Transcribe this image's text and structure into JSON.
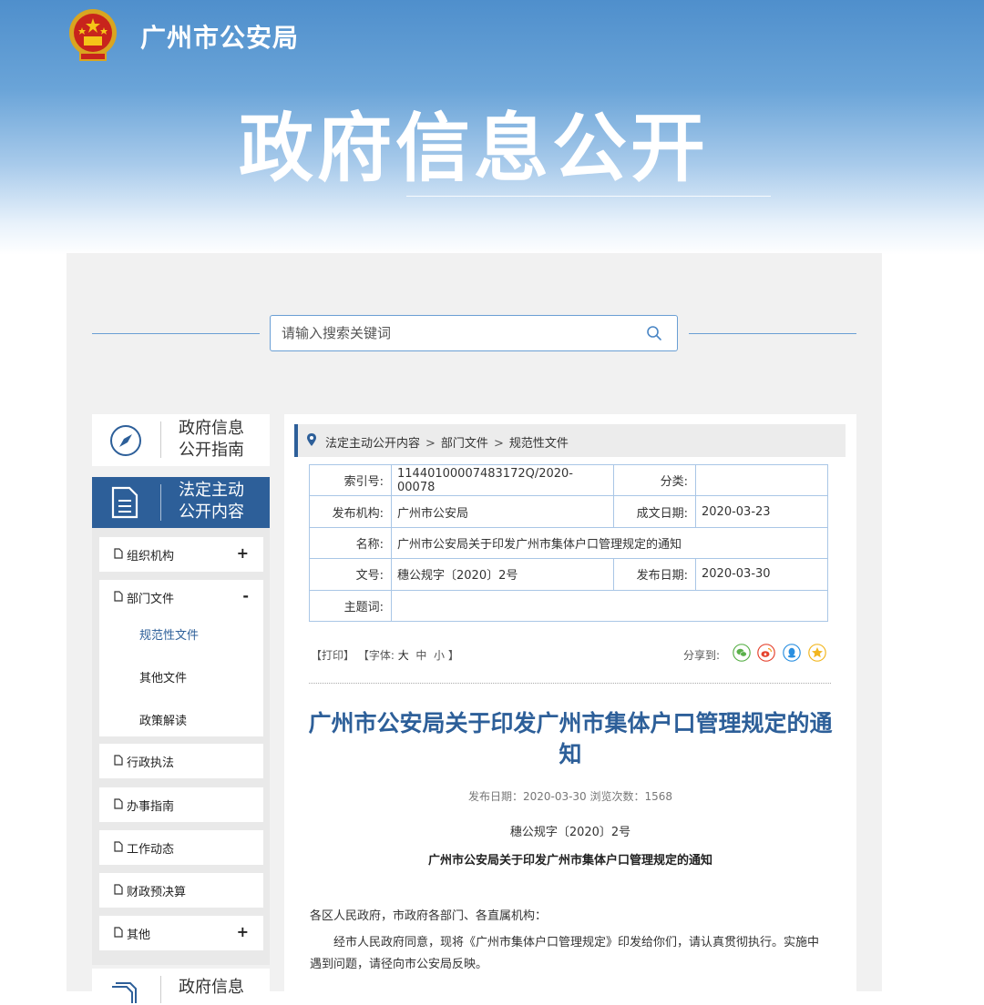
{
  "header": {
    "site_name": "广州市公安局",
    "hero_title": "政府信息公开"
  },
  "search": {
    "placeholder": "请输入搜索关键词"
  },
  "sidebar": {
    "guide_line1": "政府信息",
    "guide_line2": "公开指南",
    "active_line1": "法定主动",
    "active_line2": "公开内容",
    "items": [
      {
        "label": "组织机构",
        "sign": "+"
      },
      {
        "label": "部门文件",
        "sign": "-"
      },
      {
        "label": "行政执法",
        "sign": ""
      },
      {
        "label": "办事指南",
        "sign": ""
      },
      {
        "label": "工作动态",
        "sign": ""
      },
      {
        "label": "财政预决算",
        "sign": ""
      },
      {
        "label": "其他",
        "sign": "+"
      }
    ],
    "sub_items": [
      {
        "label": "规范性文件"
      },
      {
        "label": "其他文件"
      },
      {
        "label": "政策解读"
      }
    ],
    "bottom_line1": "政府信息"
  },
  "breadcrumb": {
    "items": [
      "法定主动公开内容",
      "部门文件",
      "规范性文件"
    ],
    "sep": ">"
  },
  "meta": {
    "index_label": "索引号:",
    "index_value": "11440100007483172Q/2020-00078",
    "category_label": "分类:",
    "category_value": "",
    "publisher_label": "发布机构:",
    "publisher_value": "广州市公安局",
    "created_label": "成文日期:",
    "created_value": "2020-03-23",
    "name_label": "名称:",
    "name_value": "广州市公安局关于印发广州市集体户口管理规定的通知",
    "docno_label": "文号:",
    "docno_value": "穗公规字〔2020〕2号",
    "pubdate_label": "发布日期:",
    "pubdate_value": "2020-03-30",
    "keyword_label": "主题词:",
    "keyword_value": ""
  },
  "tools": {
    "print": "【打印】",
    "font_prefix": "【字体:",
    "font_large": "大",
    "font_medium": "中",
    "font_small": "小",
    "font_suffix": "】",
    "share_label": "分享到:"
  },
  "share_icons": [
    {
      "name": "wechat-icon",
      "color": "#5ab04a"
    },
    {
      "name": "weibo-icon",
      "color": "#e5432f"
    },
    {
      "name": "qq-icon",
      "color": "#2a8fe0"
    },
    {
      "name": "qzone-icon",
      "color": "#f2b61f"
    }
  ],
  "article": {
    "title": "广州市公安局关于印发广州市集体户口管理规定的通知",
    "pubinfo": "发布日期：2020-03-30  浏览次数：1568",
    "docno": "穗公规字〔2020〕2号",
    "subtitle": "广州市公安局关于印发广州市集体户口管理规定的通知",
    "para1": "各区人民政府，市政府各部门、各直属机构：",
    "para2": "经市人民政府同意，现将《广州市集体户口管理规定》印发给你们，请认真贯彻执行。实施中遇到问题，请径向市公安局反映。"
  },
  "colors": {
    "accent": "#2d5f99",
    "border": "#a9c6e6"
  }
}
